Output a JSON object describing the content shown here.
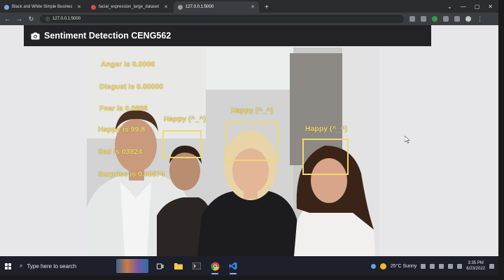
{
  "browser": {
    "tabs": [
      {
        "label": "Black and White Simple Busines",
        "active": false
      },
      {
        "label": "facial_expression_large_dataset",
        "active": false
      },
      {
        "label": "127.0.0.1:5000",
        "active": true
      }
    ],
    "new_tab_glyph": "+",
    "url": "127.0.0.1:5000"
  },
  "app": {
    "title": "Sentiment Detection CENG562",
    "title_icon": "camera-icon"
  },
  "emotions": [
    {
      "label": "Anger is 0.0008"
    },
    {
      "label": "Disgust is 0.00000"
    },
    {
      "label": "Fear is 0.0888"
    },
    {
      "label": "Happy is 99.8"
    },
    {
      "label": "Sad is 03824"
    },
    {
      "label": "Surprise is 0.00874"
    }
  ],
  "faces": [
    {
      "label": "Happy  (^_^)"
    },
    {
      "label": "Happy  (^_^)"
    },
    {
      "label": "Happy  (^_^)"
    }
  ],
  "colors": {
    "overlay_text": "#f0d870",
    "navbar": "#232325",
    "taskbar": "#1d1f2a"
  },
  "taskbar": {
    "search_placeholder": "Type here to search",
    "weather": "25°C  Sunny",
    "time": "3:35 PM",
    "date": "6/23/2022"
  }
}
